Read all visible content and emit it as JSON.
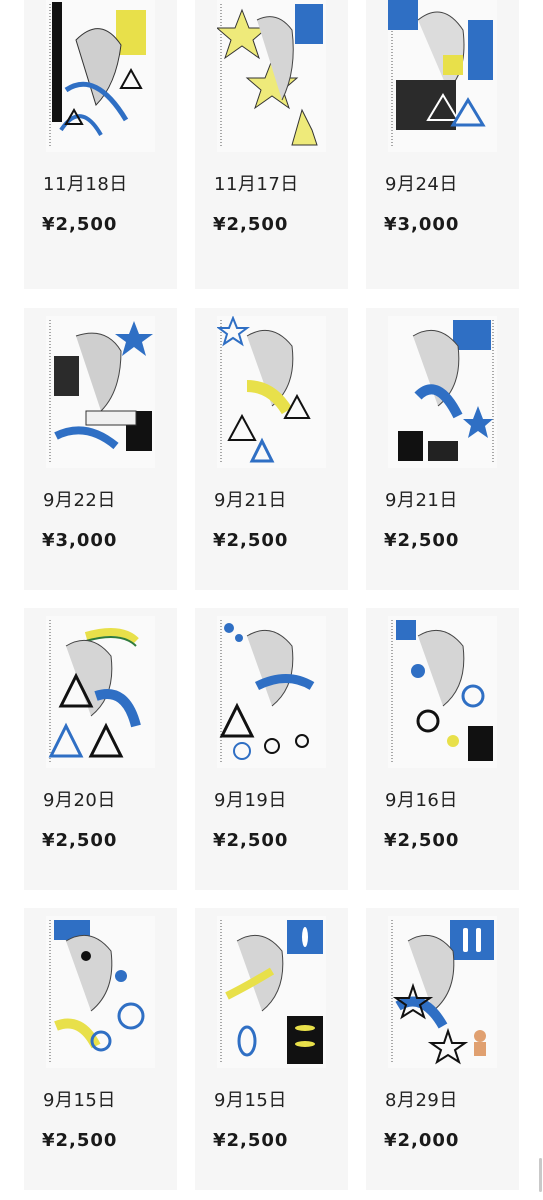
{
  "products": [
    {
      "date": "11月18日",
      "price": "¥2,500"
    },
    {
      "date": "11月17日",
      "price": "¥2,500"
    },
    {
      "date": "9月24日",
      "price": "¥3,000"
    },
    {
      "date": "9月22日",
      "price": "¥3,000"
    },
    {
      "date": "9月21日",
      "price": "¥2,500"
    },
    {
      "date": "9月21日",
      "price": "¥2,500"
    },
    {
      "date": "9月20日",
      "price": "¥2,500"
    },
    {
      "date": "9月19日",
      "price": "¥2,500"
    },
    {
      "date": "9月16日",
      "price": "¥2,500"
    },
    {
      "date": "9月15日",
      "price": "¥2,500"
    },
    {
      "date": "9月15日",
      "price": "¥2,500"
    },
    {
      "date": "8月29日",
      "price": "¥2,000"
    }
  ],
  "colors": {
    "card_bg": "#f6f6f6",
    "accent_blue": "#2f6fc4",
    "accent_yellow": "#e8e04a"
  }
}
